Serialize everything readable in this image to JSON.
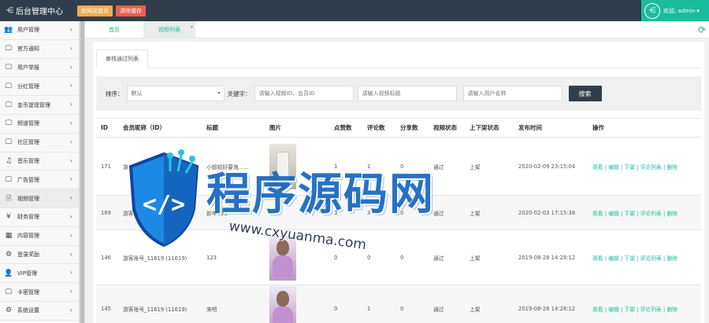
{
  "brand": {
    "title": "后台管理中心",
    "icon": "share-icon"
  },
  "top_buttons": [
    {
      "label": "新网站首页",
      "color": "#f0ad4e"
    },
    {
      "label": "清除缓存",
      "color": "#e9604e"
    }
  ],
  "user": {
    "greeting": "欢迎, admin",
    "caret": "▾"
  },
  "sidebar": {
    "items": [
      {
        "label": "用户管理",
        "icon": "users-icon",
        "glyph": "👥"
      },
      {
        "label": "官方通知",
        "icon": "monitor-icon",
        "glyph": "🖵"
      },
      {
        "label": "用户举报",
        "icon": "monitor-icon",
        "glyph": "🖵"
      },
      {
        "label": "分红管理",
        "icon": "monitor-icon",
        "glyph": "🖵"
      },
      {
        "label": "金币提现管理",
        "icon": "monitor-icon",
        "glyph": "🖵"
      },
      {
        "label": "频道管理",
        "icon": "monitor-icon",
        "glyph": "🖵"
      },
      {
        "label": "社区管理",
        "icon": "monitor-icon",
        "glyph": "🖵"
      },
      {
        "label": "音乐管理",
        "icon": "music-icon",
        "glyph": "♫"
      },
      {
        "label": "广告管理",
        "icon": "monitor-icon",
        "glyph": "🖵"
      },
      {
        "label": "视频管理",
        "icon": "file-icon",
        "glyph": "🗎"
      },
      {
        "label": "财务管理",
        "icon": "yen-icon",
        "glyph": "¥"
      },
      {
        "label": "内容管理",
        "icon": "grid-icon",
        "glyph": "▦"
      },
      {
        "label": "登录奖励",
        "icon": "gift-icon",
        "glyph": "⚙"
      },
      {
        "label": "VIP管理",
        "icon": "person-icon",
        "glyph": "👤"
      },
      {
        "label": "卡密管理",
        "icon": "monitor-icon",
        "glyph": "🖵"
      },
      {
        "label": "系统设置",
        "icon": "gears-icon",
        "glyph": "⚙"
      }
    ],
    "arrow": "›"
  },
  "tabs": {
    "home": "首页",
    "current": "视频列表",
    "close": "▾"
  },
  "subtab": "审核通过列表",
  "filter": {
    "sort_label": "排序：",
    "sort_value": "默认",
    "keyword_label": "关键字：",
    "ph_user_id": "请输入视频ID、会员ID",
    "ph_title": "请输入视频标题",
    "ph_username": "请输入用户名称",
    "search_label": "搜索"
  },
  "table": {
    "headers": [
      "ID",
      "会员昵称（ID）",
      "标题",
      "图片",
      "点赞数",
      "评论数",
      "分享数",
      "视频状态",
      "上下架状态",
      "发布时间",
      "操作"
    ],
    "rows": [
      {
        "id": "171",
        "member": "游",
        "title": "小姐姐好要逸......",
        "thumb": "door",
        "likes": "1",
        "comments": "1",
        "shares": "0",
        "status": "通过",
        "shelf": "上架",
        "time": "2020-02-09 23:15:04",
        "ops": "观看 | 编辑 | 下架 | 评论列表 | 删除"
      },
      {
        "id": "169",
        "member": "游客账号_11619 (11619)",
        "title": "新年139",
        "thumb": "none",
        "likes": "3",
        "comments": "3",
        "shares": "0",
        "status": "通过",
        "shelf": "上架",
        "time": "2020-02-03 17:15:38",
        "ops": "观看 | 编辑 | 下架 | 评论列表 | 删除"
      },
      {
        "id": "146",
        "member": "游客账号_11619 (11619)",
        "title": "123",
        "thumb": "girl",
        "likes": "0",
        "comments": "0",
        "shares": "0",
        "status": "通过",
        "shelf": "上架",
        "time": "2019-08-28 14:28:12",
        "ops": "观看 | 编辑 | 下架 | 评论列表 | 删除"
      },
      {
        "id": "145",
        "member": "游客账号_11619 (11619)",
        "title": "来吧",
        "thumb": "girl",
        "likes": "0",
        "comments": "1",
        "shares": "0",
        "status": "通过",
        "shelf": "上架",
        "time": "2019-08-28 14:28:12",
        "ops": "观看 | 编辑 | 下架 | 评论列表 | 删除"
      }
    ]
  },
  "watermark": {
    "text": "程序源码网",
    "url": "www.cxyuanma.com"
  },
  "colors": {
    "topbar": "#2f3e4a",
    "accent": "#1abc9c",
    "link": "#1abc9c"
  }
}
